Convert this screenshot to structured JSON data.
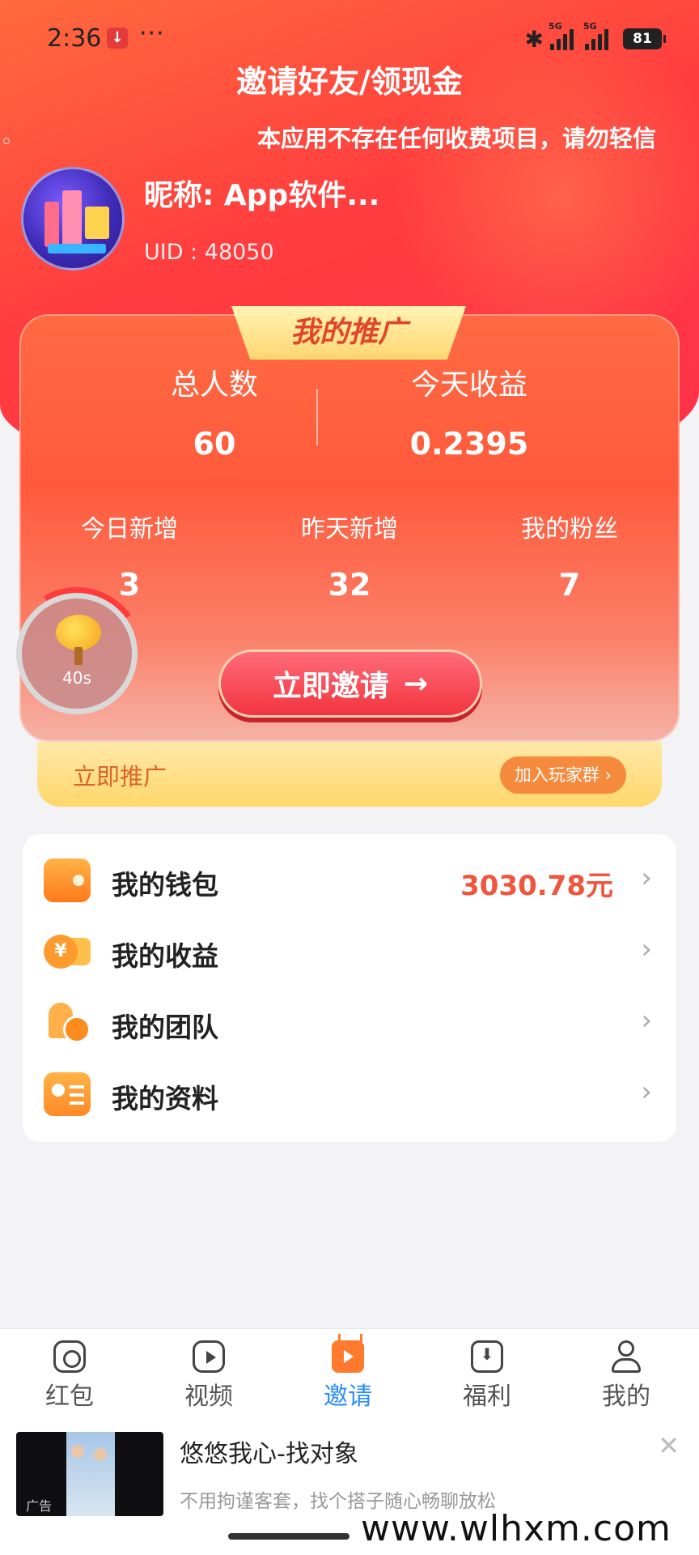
{
  "status_bar": {
    "time": "2:36",
    "dots": "···",
    "network_1": "5G",
    "network_2": "5G",
    "battery": "81",
    "icons": [
      "download-notification-icon",
      "bluetooth-icon",
      "signal-icon",
      "battery-icon"
    ]
  },
  "header": {
    "title": "邀请好友/领现金",
    "notice": "本应用不存在任何收费项目，请勿轻信"
  },
  "profile": {
    "nickname": "昵称: App软件...",
    "uid": "UID : 48050"
  },
  "promo": {
    "tab_title": "我的推广",
    "total_label": "总人数",
    "total_value": "60",
    "today_income_label": "今天收益",
    "today_income_value": "0.2395",
    "stats": [
      {
        "label": "今日新增",
        "value": "3"
      },
      {
        "label": "昨天新增",
        "value": "32"
      },
      {
        "label": "我的粉丝",
        "value": "7"
      }
    ],
    "invite_button": "立即邀请",
    "timer": "40s",
    "promote_label": "立即推广",
    "join_group": "加入玩家群 ›"
  },
  "menu": [
    {
      "label": "我的钱包",
      "value": "3030.78元",
      "icon": "wallet-icon"
    },
    {
      "label": "我的收益",
      "value": "",
      "icon": "coins-icon"
    },
    {
      "label": "我的团队",
      "value": "",
      "icon": "team-icon"
    },
    {
      "label": "我的资料",
      "value": "",
      "icon": "profile-card-icon"
    }
  ],
  "tabs": [
    {
      "label": "红包",
      "icon": "red-packet-icon",
      "active": false
    },
    {
      "label": "视频",
      "icon": "video-icon",
      "active": false
    },
    {
      "label": "邀请",
      "icon": "invite-tv-icon",
      "active": true
    },
    {
      "label": "福利",
      "icon": "gift-download-icon",
      "active": false
    },
    {
      "label": "我的",
      "icon": "user-icon",
      "active": false
    }
  ],
  "ad": {
    "badge": "广告",
    "title": "悠悠我心-找对象",
    "desc": "不用拘谨客套，找个搭子随心畅聊放松",
    "close": "✕"
  },
  "watermark": "www.wlhxm.com",
  "colors": {
    "brand_red": "#ff3d3f",
    "accent_orange": "#f0553d",
    "active_tab": "#2a8cff",
    "promote_bar": "#ffd76a"
  }
}
